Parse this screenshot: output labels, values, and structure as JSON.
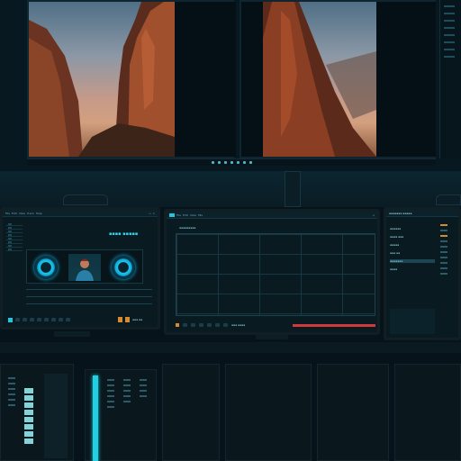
{
  "colors": {
    "accent_cyan": "#1ec7ef",
    "accent_orange": "#d88a2e",
    "accent_red": "#d23a3a",
    "background": "#07131a"
  },
  "icons": [
    "play-icon",
    "stop-icon",
    "record-icon",
    "rewind-icon",
    "forward-icon",
    "folder-icon",
    "settings-icon",
    "close-icon",
    "window-icon",
    "grid-icon"
  ],
  "left_monitor": {
    "menu": [
      "File",
      "Edit",
      "View",
      "Track",
      "Help"
    ],
    "header_code": "▪▪▪▪ ▪▪▪▪▪",
    "status": "▪▪▪ ▪▪"
  },
  "center_monitor": {
    "menu": [
      "File",
      "Edit",
      "View",
      "Mix"
    ],
    "panel_title": "▪▪▪▪▪▪▪▪▪",
    "transport": "▪▪▪ ▪▪▪▪"
  },
  "right_monitor": {
    "browser_title": "▪▪▪▪▪▪▪ ▪▪▪▪▪",
    "browser_items": [
      "▪▪▪▪▪▪",
      "▪▪▪▪ ▪▪▪",
      "▪▪▪▪▪",
      "▪▪▪ ▪▪",
      "▪▪▪▪▪▪▪",
      "▪▪▪▪"
    ]
  },
  "progress": {
    "center_timeline_fill": 1.0
  }
}
